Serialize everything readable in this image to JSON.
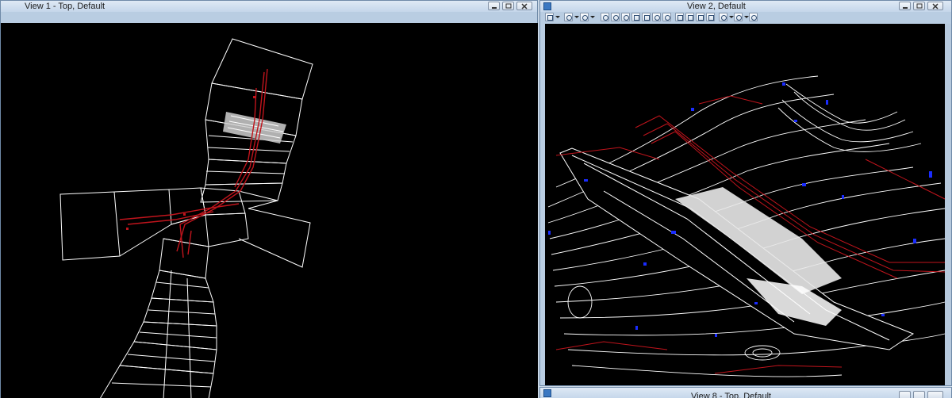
{
  "view1": {
    "title": "View 1 - Top, Default"
  },
  "view2": {
    "title": "View 2, Default"
  },
  "view8": {
    "title": "View 8 - Top, Default"
  },
  "icons": [
    "minimize-icon",
    "restore-icon",
    "close-icon"
  ],
  "colors": {
    "canvas": "#000000",
    "linework": "#ffffff",
    "alignment": "#c0141c",
    "water": "#1a2cff"
  }
}
